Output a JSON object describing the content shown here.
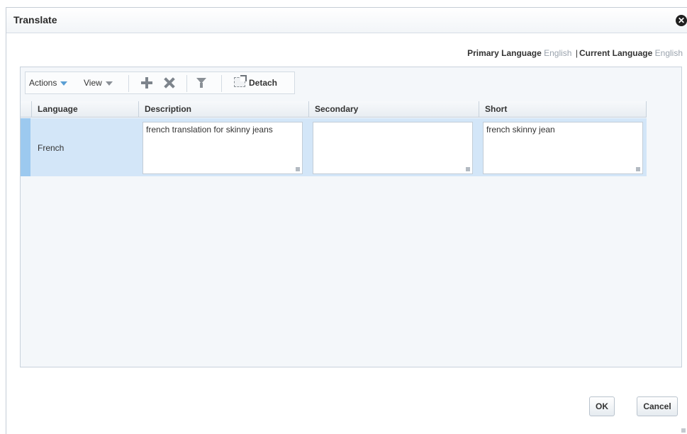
{
  "dialog": {
    "title": "Translate",
    "close_icon": "close-icon"
  },
  "language_info": {
    "primary_label": "Primary Language",
    "primary_value": "English",
    "separator": "|",
    "current_label": "Current Language",
    "current_value": "English"
  },
  "toolbar": {
    "actions_label": "Actions",
    "view_label": "View",
    "add_icon": "plus-icon",
    "delete_icon": "x-icon",
    "filter_icon": "filter-icon",
    "detach_label": "Detach"
  },
  "table": {
    "columns": [
      "Language",
      "Description",
      "Secondary",
      "Short"
    ],
    "rows": [
      {
        "language": "French",
        "description": "french translation for skinny jeans",
        "secondary": "",
        "short": "french skinny jean"
      }
    ]
  },
  "buttons": {
    "ok_label": "OK",
    "cancel_label": "Cancel"
  },
  "colors": {
    "selected_row": "#d3e6f8",
    "row_marker": "#9cc9ef",
    "dropdown_accent": "#5a9fd4"
  }
}
